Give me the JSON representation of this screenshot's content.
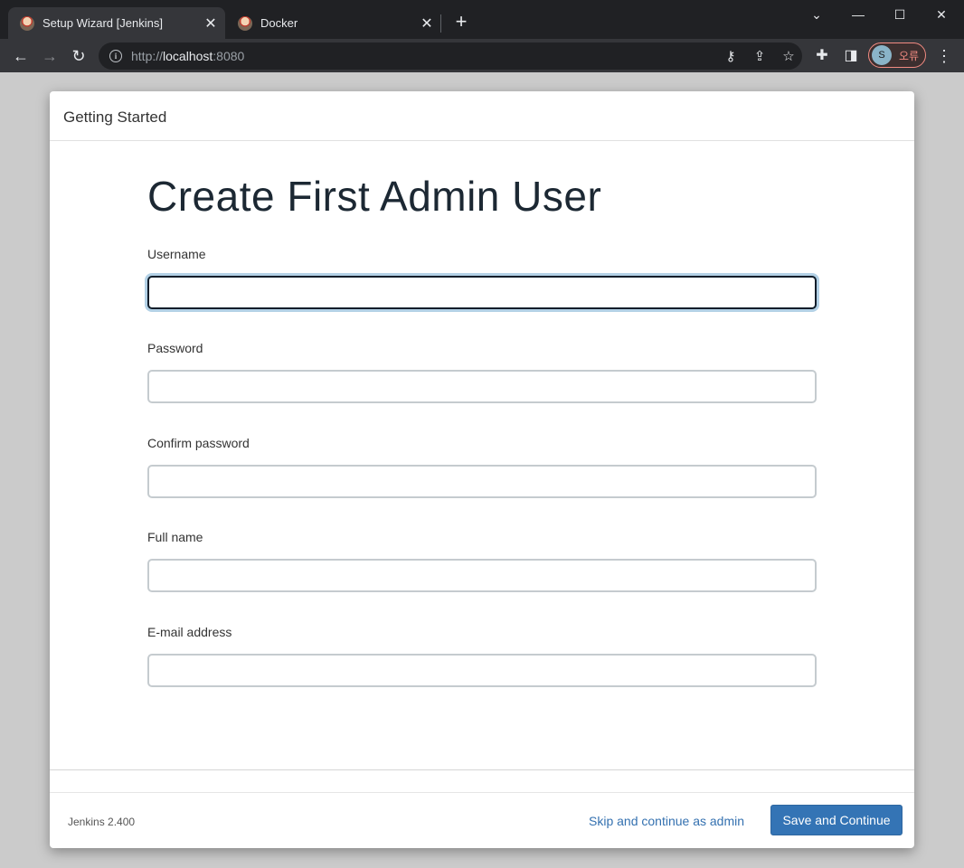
{
  "browser": {
    "tabs": [
      {
        "title": "Setup Wizard [Jenkins]",
        "active": true
      },
      {
        "title": "Docker",
        "active": false
      }
    ],
    "new_tab_label": "+",
    "url_scheme": "http://",
    "url_host": "localhost",
    "url_port": ":8080",
    "profile_initial": "S",
    "profile_status": "오류"
  },
  "dialog": {
    "header": "Getting Started",
    "title": "Create First Admin User",
    "fields": [
      {
        "label": "Username",
        "value": ""
      },
      {
        "label": "Password",
        "value": ""
      },
      {
        "label": "Confirm password",
        "value": ""
      },
      {
        "label": "Full name",
        "value": ""
      },
      {
        "label": "E-mail address",
        "value": ""
      }
    ],
    "version": "Jenkins 2.400",
    "skip_label": "Skip and continue as admin",
    "save_label": "Save and Continue"
  },
  "colors": {
    "primary_button": "#3474b5",
    "link": "#3471b0",
    "error_accent": "#f28b82"
  }
}
